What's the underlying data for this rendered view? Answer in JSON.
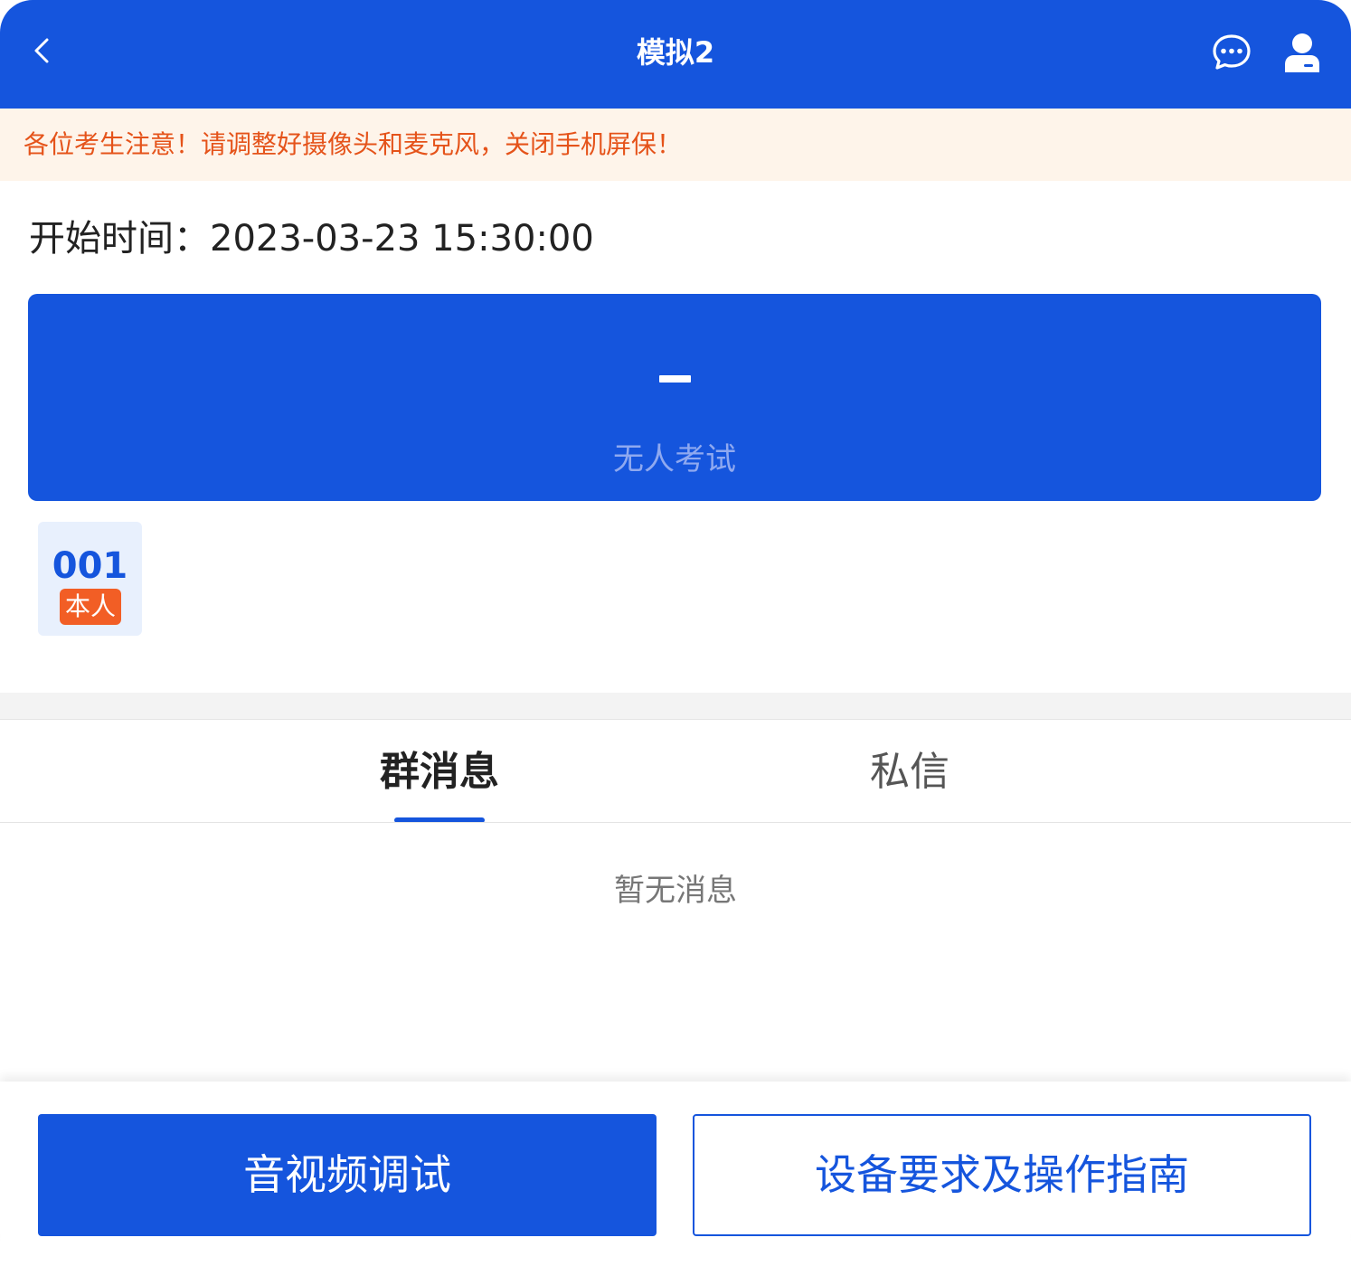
{
  "header": {
    "title": "模拟2",
    "back_icon": "chevron-left-icon",
    "chat_icon": "chat-bubble-icon",
    "user_icon": "user-icon"
  },
  "notice": {
    "text": "各位考生注意！请调整好摄像头和麦克风，关闭手机屏保！"
  },
  "exam": {
    "start_time_label": "开始时间：",
    "start_time": "2023-03-23 15:30:00",
    "status": "无人考试"
  },
  "seat": {
    "number": "001",
    "badge": "本人"
  },
  "tabs": {
    "items": [
      {
        "label": "群消息",
        "active": true
      },
      {
        "label": "私信",
        "active": false
      }
    ]
  },
  "messages": {
    "empty": "暂无消息"
  },
  "footer": {
    "primary_label": "音视频调试",
    "secondary_label": "设备要求及操作指南"
  },
  "colors": {
    "primary": "#1555DD",
    "notice_bg": "#FEF4EA",
    "notice_text": "#E5531A",
    "badge": "#F25E25"
  }
}
